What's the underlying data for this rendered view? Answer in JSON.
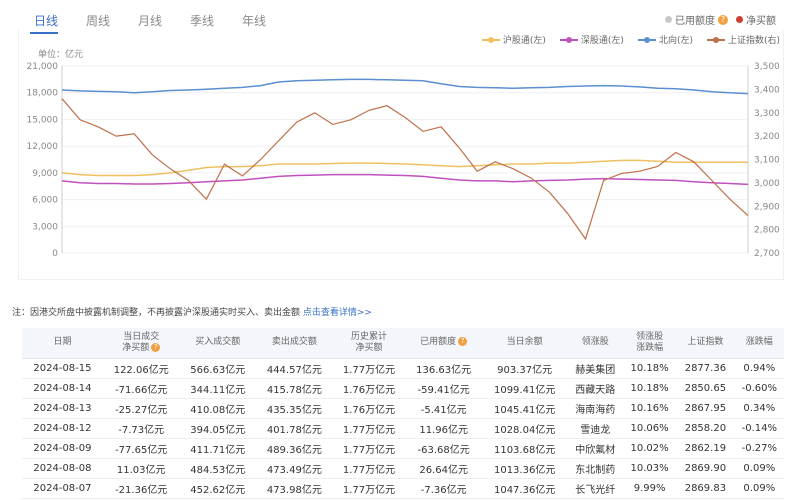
{
  "tabs": {
    "items": [
      "日线",
      "周线",
      "月线",
      "季线",
      "年线"
    ],
    "active": 0
  },
  "toggles": {
    "used_quota": "已用额度",
    "net_buy": "净买额",
    "help": "?"
  },
  "legend": {
    "items": [
      {
        "label": "沪股通(左)",
        "color": "#f0c060"
      },
      {
        "label": "深股通(左)",
        "color": "#c050c0"
      },
      {
        "label": "北向(左)",
        "color": "#5a8fd0"
      },
      {
        "label": "上证指数(右)",
        "color": "#c0704a"
      }
    ]
  },
  "unit_label": "单位：亿元",
  "note": {
    "prefix": "注：因港交所盘中披露机制调整，不再披露沪深股通实时买入、卖出金额",
    "link": "点击查看详情>>"
  },
  "chart_data": {
    "type": "line",
    "y_left": {
      "min": 0,
      "max": 21000,
      "ticks": [
        "0",
        "3,000",
        "6,000",
        "9,000",
        "12,000",
        "15,000",
        "18,000",
        "21,000"
      ]
    },
    "y_right": {
      "min": 2700,
      "max": 3500,
      "ticks": [
        "2,700",
        "2,800",
        "2,900",
        "3,000",
        "3,100",
        "3,200",
        "3,300",
        "3,400",
        "3,500"
      ]
    },
    "series": [
      {
        "name": "北向(左)",
        "axis": "left",
        "color": "#5a8fd0",
        "values": [
          18300,
          18200,
          18150,
          18100,
          18000,
          18100,
          18250,
          18300,
          18400,
          18500,
          18600,
          18800,
          19200,
          19350,
          19400,
          19450,
          19500,
          19500,
          19450,
          19400,
          19350,
          19000,
          18700,
          18600,
          18550,
          18500,
          18550,
          18600,
          18700,
          18750,
          18800,
          18750,
          18650,
          18500,
          18450,
          18300,
          18100,
          18000,
          17900
        ]
      },
      {
        "name": "沪股通(左)",
        "axis": "left",
        "color": "#f0c060",
        "values": [
          9000,
          8800,
          8700,
          8700,
          8700,
          8800,
          9000,
          9300,
          9600,
          9700,
          9700,
          9800,
          10000,
          10000,
          10000,
          10050,
          10100,
          10100,
          10050,
          10000,
          9900,
          9800,
          9700,
          9800,
          9900,
          10000,
          10000,
          10100,
          10100,
          10200,
          10300,
          10400,
          10400,
          10300,
          10200,
          10200,
          10200,
          10200,
          10200
        ]
      },
      {
        "name": "深股通(左)",
        "axis": "left",
        "color": "#c050c0",
        "values": [
          8100,
          7900,
          7800,
          7800,
          7750,
          7750,
          7800,
          7900,
          8000,
          8100,
          8200,
          8400,
          8600,
          8700,
          8750,
          8800,
          8800,
          8800,
          8750,
          8700,
          8600,
          8400,
          8200,
          8100,
          8100,
          8000,
          8100,
          8150,
          8200,
          8300,
          8350,
          8300,
          8250,
          8200,
          8150,
          8000,
          7900,
          7800,
          7700
        ]
      },
      {
        "name": "上证指数(右)",
        "axis": "right",
        "color": "#c0704a",
        "values": [
          3360,
          3270,
          3240,
          3200,
          3210,
          3120,
          3060,
          3010,
          2930,
          3080,
          3030,
          3100,
          3180,
          3260,
          3300,
          3250,
          3270,
          3310,
          3330,
          3280,
          3220,
          3240,
          3150,
          3050,
          3090,
          3060,
          3020,
          2960,
          2870,
          2760,
          3010,
          3040,
          3050,
          3070,
          3130,
          3090,
          3010,
          2930,
          2860
        ]
      }
    ]
  },
  "table": {
    "headers": [
      "日期",
      "当日成交\n净买额",
      "买入成交额",
      "卖出成交额",
      "历史累计\n净买额",
      "已用额度",
      "当日余额",
      "领涨股",
      "领涨股\n涨跌幅",
      "上证指数",
      "涨跌幅"
    ],
    "rows": [
      [
        "2024-08-15",
        "122.06亿元",
        "566.63亿元",
        "444.57亿元",
        "1.77万亿元",
        "136.63亿元",
        "903.37亿元",
        "赫美集团",
        "10.18%",
        "2877.36",
        "0.94%"
      ],
      [
        "2024-08-14",
        "-71.66亿元",
        "344.11亿元",
        "415.78亿元",
        "1.76万亿元",
        "-59.41亿元",
        "1099.41亿元",
        "西藏天路",
        "10.18%",
        "2850.65",
        "-0.60%"
      ],
      [
        "2024-08-13",
        "-25.27亿元",
        "410.08亿元",
        "435.35亿元",
        "1.76万亿元",
        "-5.41亿元",
        "1045.41亿元",
        "海南海药",
        "10.16%",
        "2867.95",
        "0.34%"
      ],
      [
        "2024-08-12",
        "-7.73亿元",
        "394.05亿元",
        "401.78亿元",
        "1.77万亿元",
        "11.96亿元",
        "1028.04亿元",
        "雪迪龙",
        "10.06%",
        "2858.20",
        "-0.14%"
      ],
      [
        "2024-08-09",
        "-77.65亿元",
        "411.71亿元",
        "489.36亿元",
        "1.77万亿元",
        "-63.68亿元",
        "1103.68亿元",
        "中欣氟材",
        "10.02%",
        "2862.19",
        "-0.27%"
      ],
      [
        "2024-08-08",
        "11.03亿元",
        "484.53亿元",
        "473.49亿元",
        "1.77万亿元",
        "26.64亿元",
        "1013.36亿元",
        "东北制药",
        "10.03%",
        "2869.90",
        "0.09%"
      ],
      [
        "2024-08-07",
        "-21.36亿元",
        "452.62亿元",
        "473.98亿元",
        "1.77万亿元",
        "-7.36亿元",
        "1047.36亿元",
        "长飞光纤",
        "9.99%",
        "2869.83",
        "0.09%"
      ]
    ]
  }
}
